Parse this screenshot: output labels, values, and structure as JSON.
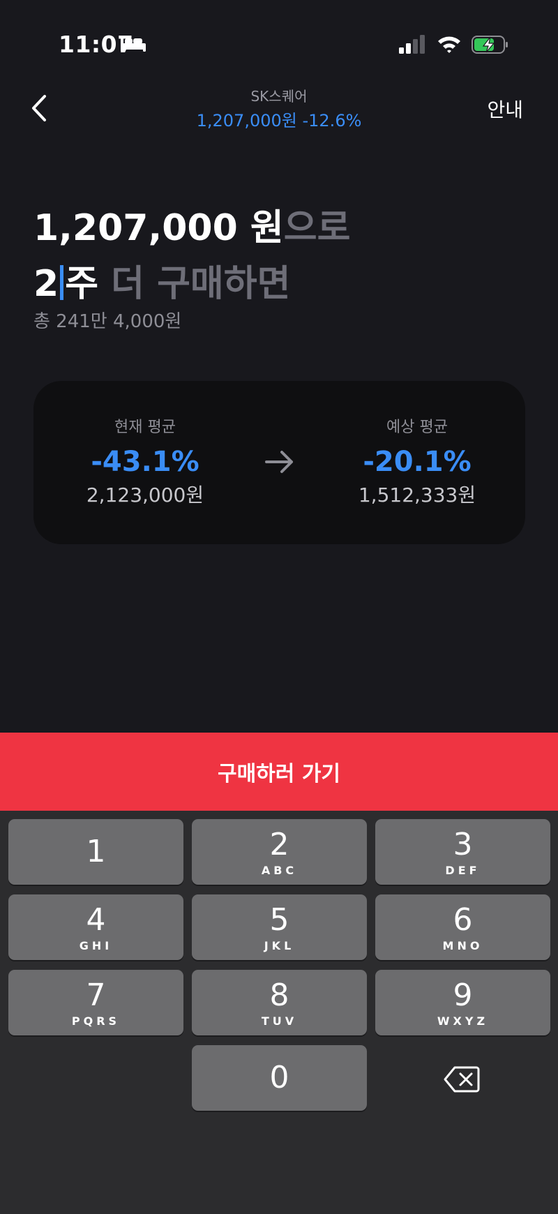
{
  "status_bar": {
    "time": "11:07"
  },
  "nav": {
    "stock_name": "SK스퀘어",
    "price": "1,207,000원",
    "change": "-12.6%",
    "guide_label": "안내"
  },
  "headline": {
    "price": "1,207,000 원",
    "price_suffix": "으로",
    "qty": "2",
    "qty_unit": "주",
    "action": " 더 구매하면",
    "total": "총 241만 4,000원"
  },
  "average": {
    "current_label": "현재 평균",
    "current_pct": "-43.1%",
    "current_price": "2,123,000원",
    "expected_label": "예상 평균",
    "expected_pct": "-20.1%",
    "expected_price": "1,512,333원"
  },
  "buy_button_label": "구매하러 가기",
  "keypad": {
    "keys": [
      {
        "digit": "1",
        "letters": ""
      },
      {
        "digit": "2",
        "letters": "ABC"
      },
      {
        "digit": "3",
        "letters": "DEF"
      },
      {
        "digit": "4",
        "letters": "GHI"
      },
      {
        "digit": "5",
        "letters": "JKL"
      },
      {
        "digit": "6",
        "letters": "MNO"
      },
      {
        "digit": "7",
        "letters": "PQRS"
      },
      {
        "digit": "8",
        "letters": "TUV"
      },
      {
        "digit": "9",
        "letters": "WXYZ"
      },
      {
        "digit": "0",
        "letters": ""
      }
    ]
  },
  "colors": {
    "accent_blue": "#3a8df6",
    "buy_red": "#ef3442",
    "background": "#18181d",
    "card": "#0f0f11",
    "key": "#6c6c6e",
    "battery_green": "#34c759"
  }
}
